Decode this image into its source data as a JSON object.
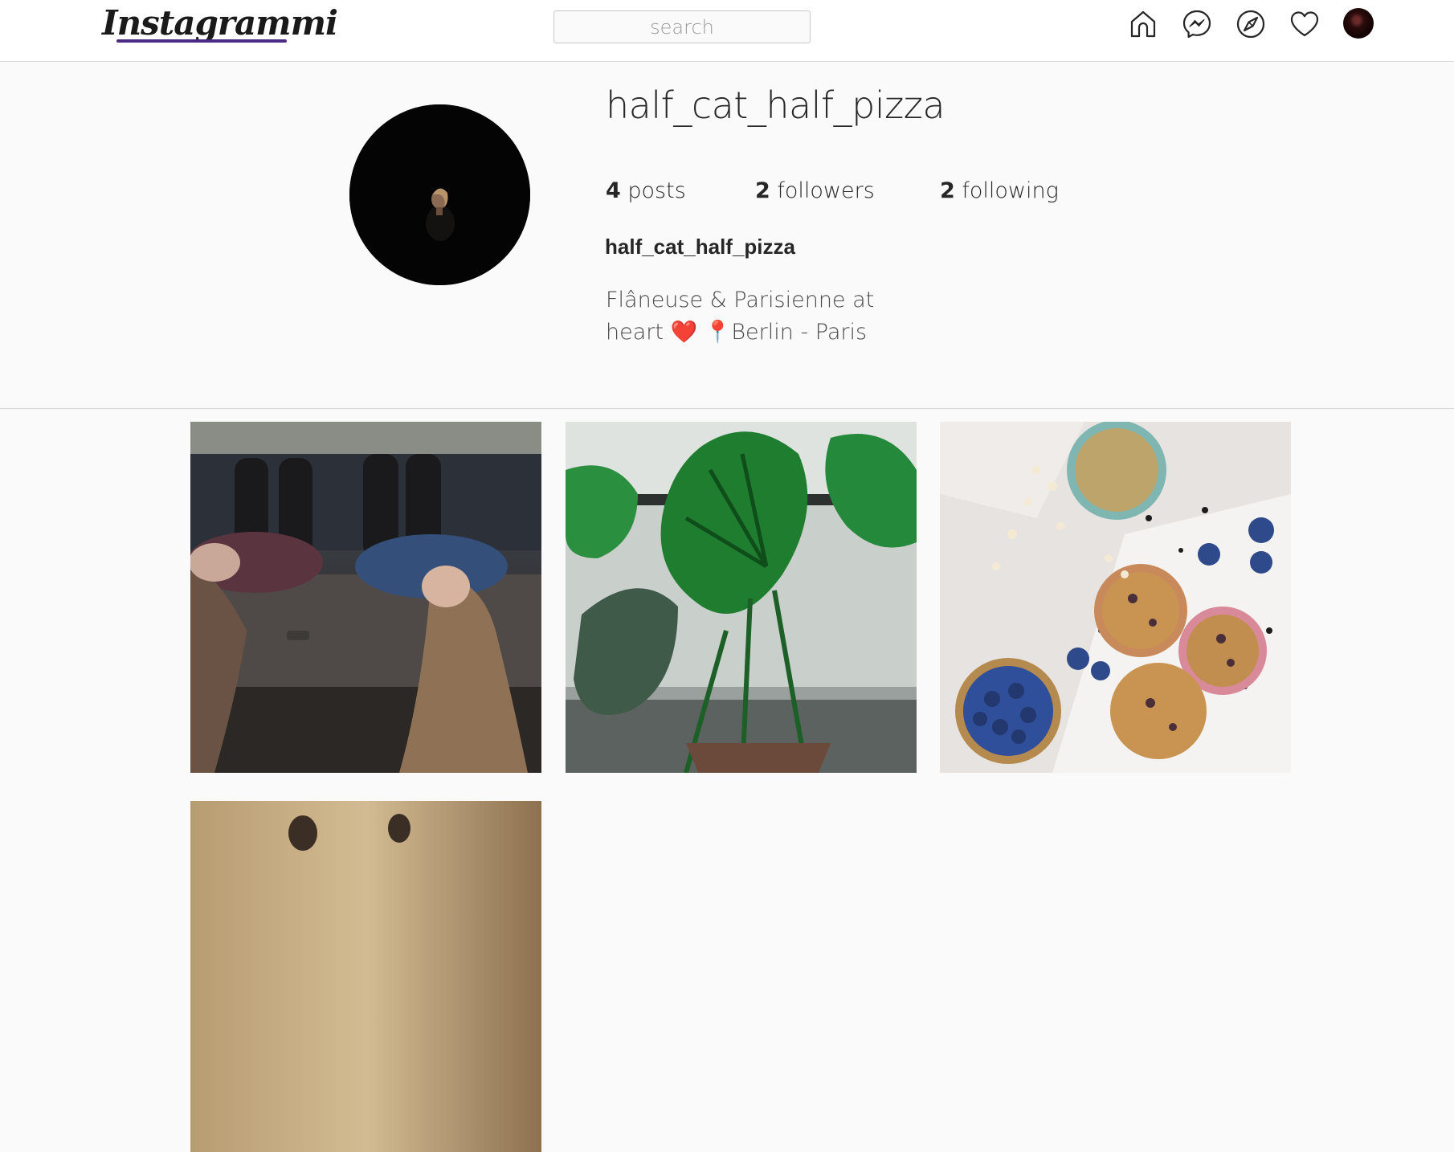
{
  "app": {
    "logo_text": "Instagrammi",
    "brand_accent": "#4b2a86"
  },
  "search": {
    "placeholder": "search"
  },
  "nav": {
    "icons": [
      "home-icon",
      "messenger-icon",
      "compass-icon",
      "heart-icon",
      "profile-avatar"
    ]
  },
  "profile": {
    "username": "half_cat_half_pizza",
    "stats": {
      "posts_count": "4",
      "posts_label": "posts",
      "followers_count": "2",
      "followers_label": "followers",
      "following_count": "2",
      "following_label": "following"
    },
    "full_name": "half_cat_half_pizza",
    "bio_line1": "Flâneuse & Parisienne at",
    "bio_line2": "heart ❤️ 📍Berlin - Paris"
  },
  "posts": [
    {
      "subject": "two-women-lying-on-truck"
    },
    {
      "subject": "monstera-plant"
    },
    {
      "subject": "blueberry-muffins-and-tea"
    },
    {
      "subject": "fourth-post"
    }
  ]
}
